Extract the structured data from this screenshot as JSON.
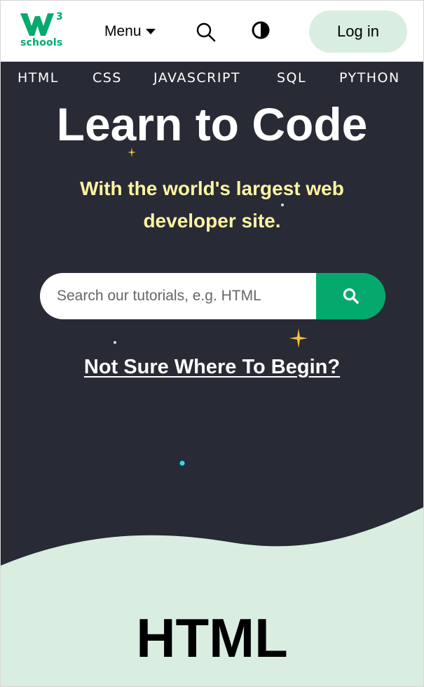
{
  "header": {
    "logo_text": "schools",
    "logo_mark": "w3",
    "menu_label": "Menu",
    "login_label": "Log in",
    "icons": [
      "search-icon",
      "contrast-icon",
      "chevron-down-icon"
    ]
  },
  "nav": {
    "items": [
      "HTML",
      "CSS",
      "JAVASCRIPT",
      "SQL",
      "PYTHON"
    ]
  },
  "hero": {
    "title": "Learn to Code",
    "subtitle_line1": "With the world's largest web",
    "subtitle_line2": "developer site.",
    "search_placeholder": "Search our tutorials, e.g. HTML",
    "begin_link": "Not Sure Where To Begin?"
  },
  "section": {
    "title": "HTML"
  },
  "colors": {
    "brand_green": "#04aa6d",
    "hero_bg": "#282a35",
    "subtitle_yellow": "#fff4a3",
    "login_bg": "#d9eee1",
    "section_bg": "#d9eee1"
  }
}
